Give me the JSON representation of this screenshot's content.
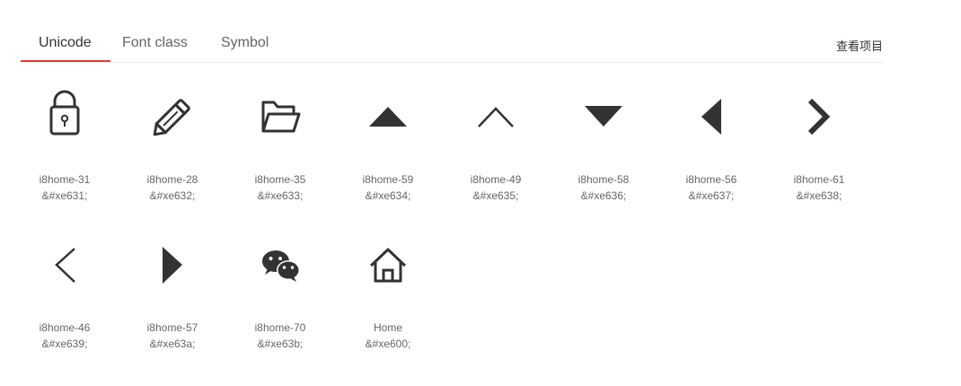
{
  "tabs": [
    {
      "label": "Unicode",
      "active": true
    },
    {
      "label": "Font class",
      "active": false
    },
    {
      "label": "Symbol",
      "active": false
    }
  ],
  "view_project": "查看项目",
  "accent_color": "#e4393c",
  "icons": [
    {
      "name": "i8home-31",
      "code": "&#xe631;",
      "icon": "lock-icon"
    },
    {
      "name": "i8home-28",
      "code": "&#xe632;",
      "icon": "pencil-icon"
    },
    {
      "name": "i8home-35",
      "code": "&#xe633;",
      "icon": "folder-open-icon"
    },
    {
      "name": "i8home-59",
      "code": "&#xe634;",
      "icon": "triangle-up-icon"
    },
    {
      "name": "i8home-49",
      "code": "&#xe635;",
      "icon": "chevron-up-icon"
    },
    {
      "name": "i8home-58",
      "code": "&#xe636;",
      "icon": "triangle-down-icon"
    },
    {
      "name": "i8home-56",
      "code": "&#xe637;",
      "icon": "triangle-left-icon"
    },
    {
      "name": "i8home-61",
      "code": "&#xe638;",
      "icon": "chevron-right-bold-icon"
    },
    {
      "name": "i8home-46",
      "code": "&#xe639;",
      "icon": "chevron-left-icon"
    },
    {
      "name": "i8home-57",
      "code": "&#xe63a;",
      "icon": "triangle-right-icon"
    },
    {
      "name": "i8home-70",
      "code": "&#xe63b;",
      "icon": "wechat-icon"
    },
    {
      "name": "Home",
      "code": "&#xe600;",
      "icon": "home-icon"
    }
  ]
}
